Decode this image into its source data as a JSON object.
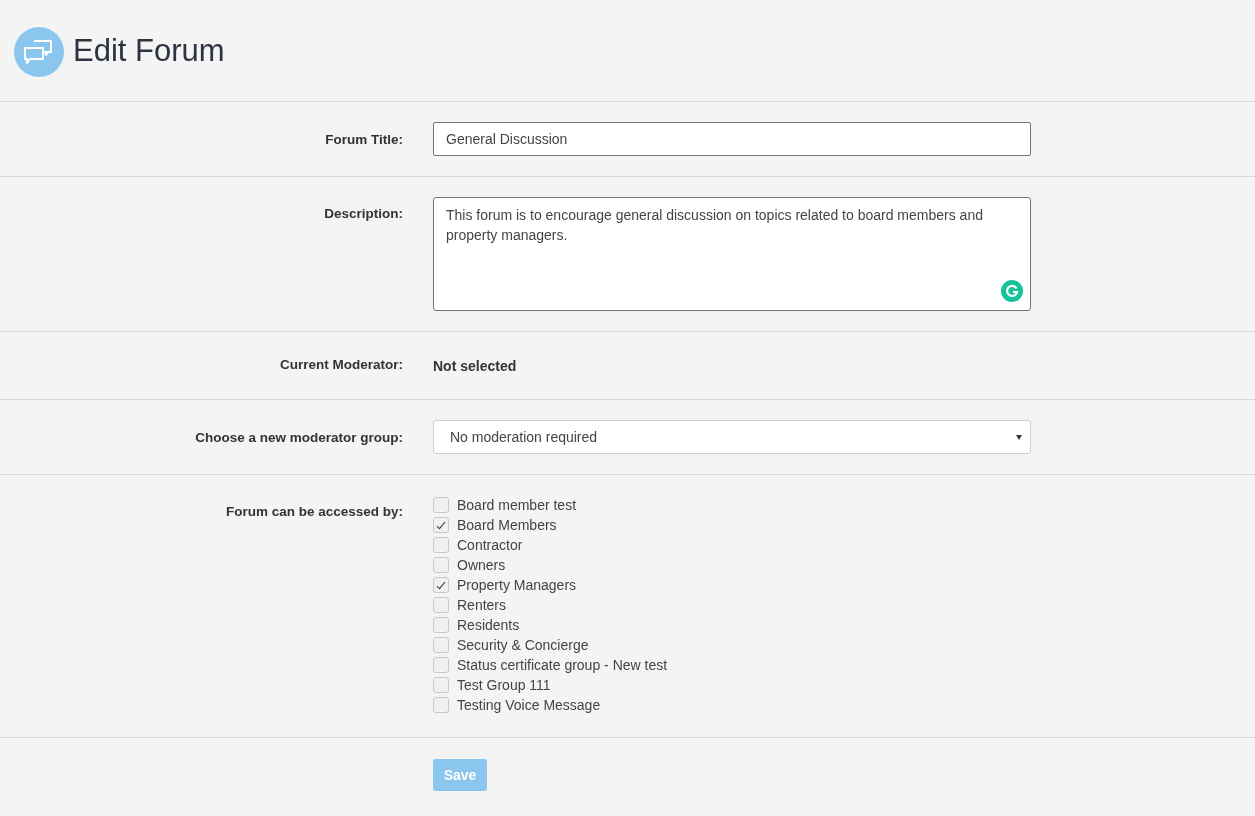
{
  "page": {
    "title": "Edit Forum"
  },
  "fields": [
    {
      "kind": "text",
      "label": "Forum Title:",
      "value": "General Discussion"
    },
    {
      "kind": "textarea",
      "label": "Description:",
      "value": "This forum is to encourage general discussion on topics related to board members and property managers."
    },
    {
      "kind": "static",
      "label": "Current Moderator:",
      "value": "Not selected"
    },
    {
      "kind": "select",
      "label": "Choose a new moderator group:",
      "value": "No moderation required"
    },
    {
      "kind": "checklist",
      "label": "Forum can be accessed by:",
      "options": [
        {
          "label": "Board member test",
          "checked": false
        },
        {
          "label": "Board Members",
          "checked": true
        },
        {
          "label": "Contractor",
          "checked": false
        },
        {
          "label": "Owners",
          "checked": false
        },
        {
          "label": "Property Managers",
          "checked": true
        },
        {
          "label": "Renters",
          "checked": false
        },
        {
          "label": "Residents",
          "checked": false
        },
        {
          "label": "Security & Concierge",
          "checked": false
        },
        {
          "label": "Status certificate group - New test",
          "checked": false
        },
        {
          "label": "Test Group 111",
          "checked": false
        },
        {
          "label": "Testing Voice Message",
          "checked": false
        }
      ]
    }
  ],
  "save_button": {
    "label": "Save"
  }
}
